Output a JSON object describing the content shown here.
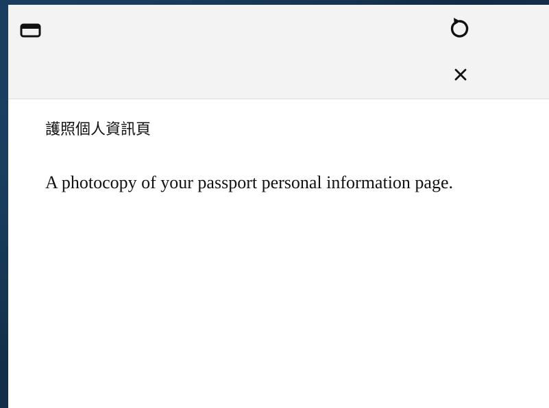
{
  "toolbar": {
    "icons": {
      "window": "window-icon",
      "refresh": "refresh-icon",
      "close": "close-icon"
    }
  },
  "content": {
    "heading": "護照個人資訊頁",
    "description": "A photocopy of your passport personal information page."
  },
  "colors": {
    "background": "#16344f",
    "panel": "#ffffff",
    "toolbar": "#f3f3f3",
    "text": "#111111"
  }
}
